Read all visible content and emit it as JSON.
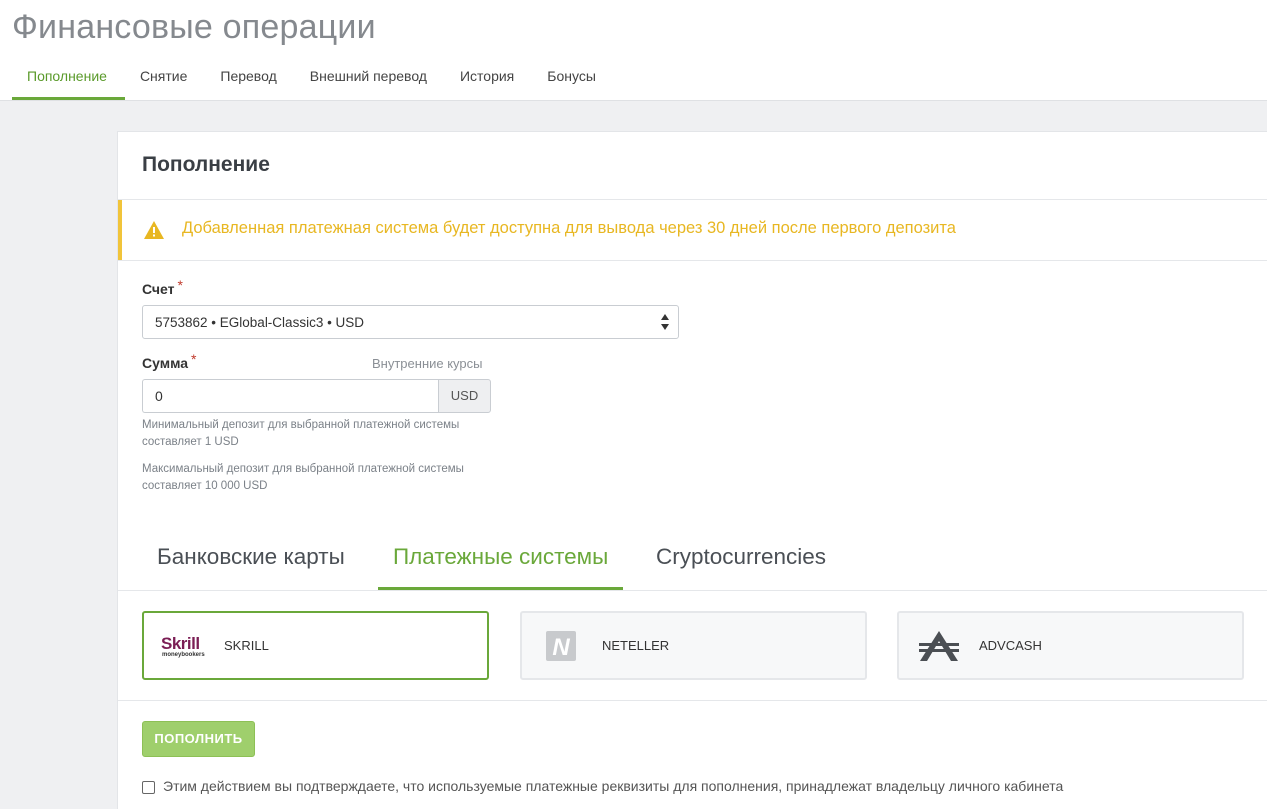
{
  "header": {
    "title": "Финансовые операции",
    "nav": [
      {
        "label": "Пополнение",
        "active": true
      },
      {
        "label": "Снятие"
      },
      {
        "label": "Перевод"
      },
      {
        "label": "Внешний перевод"
      },
      {
        "label": "История"
      },
      {
        "label": "Бонусы"
      }
    ]
  },
  "deposit": {
    "title": "Пополнение",
    "alert": "Добавленная платежная система будет доступна для вывода через 30 дней после первого депозита",
    "account": {
      "label": "Счет",
      "required_mark": "*",
      "value": "5753862 • EGlobal-Classic3 • USD"
    },
    "amount": {
      "label": "Сумма",
      "required_mark": "*",
      "rates_link": "Внутренние курсы",
      "value": "0",
      "currency": "USD",
      "hint_min": [
        "Минимальный депозит для выбранной платежной системы",
        "составляет 1 USD"
      ],
      "hint_max": [
        "Максимальный депозит для выбранной платежной системы",
        "составляет 10 000 USD"
      ]
    },
    "payment_tabs": [
      {
        "label": "Банковские карты"
      },
      {
        "label": "Платежные системы",
        "active": true
      },
      {
        "label": "Cryptocurrencies"
      }
    ],
    "methods": [
      {
        "label": "SKRILL",
        "logo_text": "Skrill",
        "logo_sub": "moneybookers",
        "selected": true
      },
      {
        "label": "NETELLER",
        "logo_text": "N"
      },
      {
        "label": "ADVCASH"
      }
    ],
    "submit_label": "ПОПОЛНИТЬ",
    "confirm_text": "Этим действием вы подтверждаете, что используемые платежные реквизиты для пополнения, принадлежат владельцу личного кабинета",
    "colors": {
      "accent": "#6aa83a",
      "warning": "#e8b722",
      "button": "#9fcf6c",
      "skrill": "#7b1e55"
    }
  }
}
